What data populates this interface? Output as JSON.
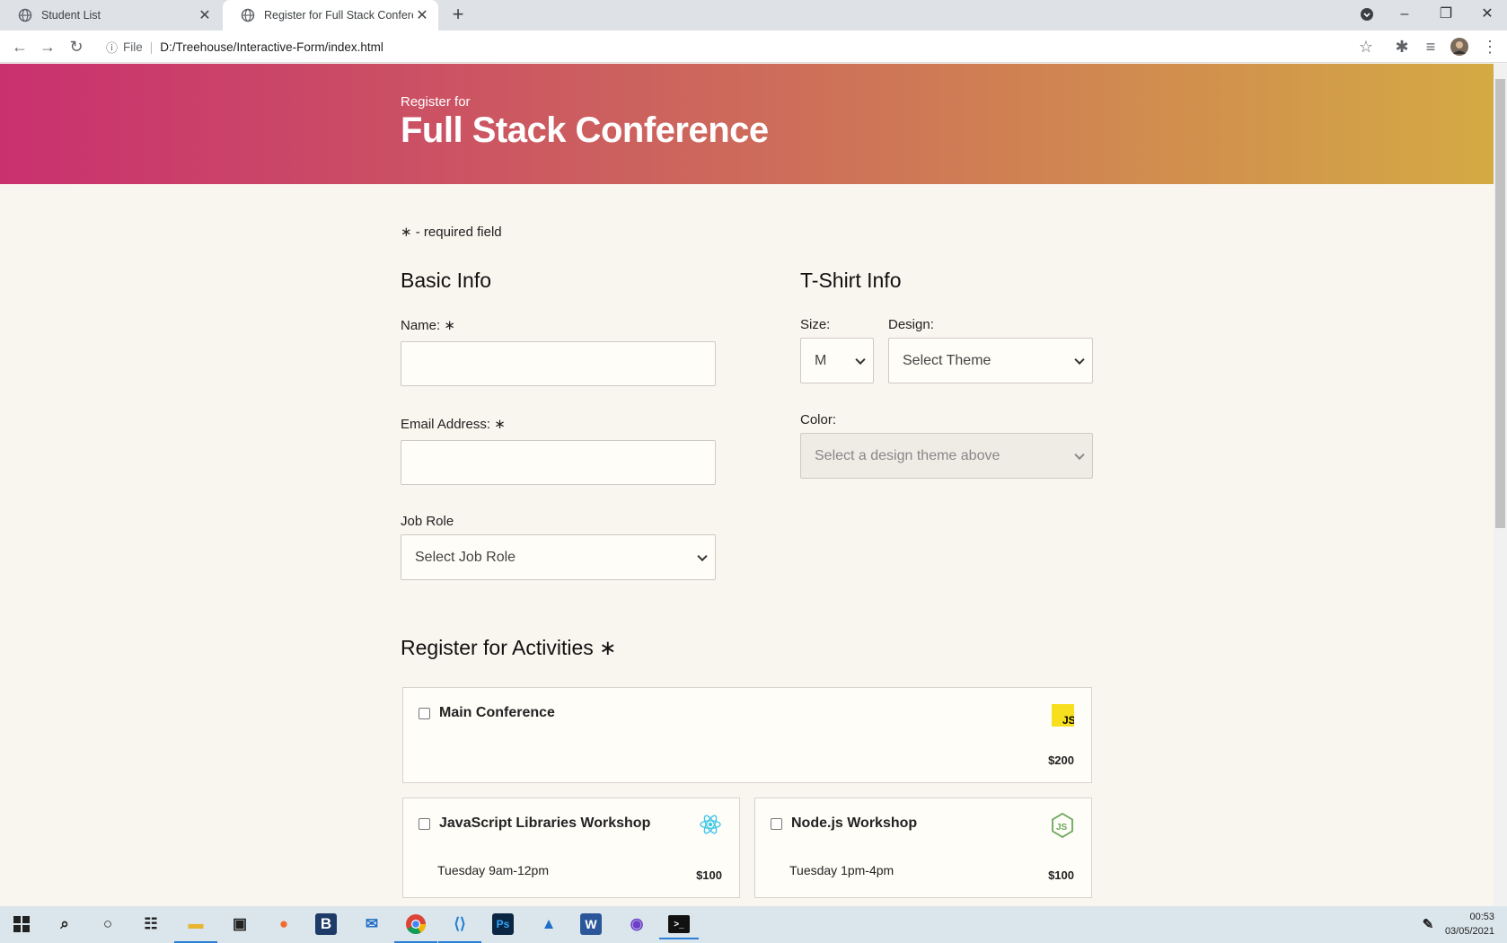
{
  "browser": {
    "tabs": [
      {
        "title": "Student List"
      },
      {
        "title": "Register for Full Stack Conference"
      }
    ],
    "address_prefix": "File",
    "url": "D:/Treehouse/Interactive-Form/index.html"
  },
  "header": {
    "subtitle": "Register for",
    "title": "Full Stack Conference"
  },
  "form": {
    "required_note": "- required field",
    "basic_info": {
      "heading": "Basic Info",
      "name_label": "Name:",
      "email_label": "Email Address:",
      "job_role_label": "Job Role",
      "job_role_value": "Select Job Role"
    },
    "tshirt": {
      "heading": "T-Shirt Info",
      "size_label": "Size:",
      "size_value": "M",
      "design_label": "Design:",
      "design_value": "Select Theme",
      "color_label": "Color:",
      "color_value": "Select a design theme above"
    },
    "activities": {
      "heading": "Register for Activities",
      "items": [
        {
          "name": "Main Conference",
          "when": "",
          "cost": "$200",
          "icon": "js-icon"
        },
        {
          "name": "JavaScript Libraries Workshop",
          "when": "Tuesday 9am-12pm",
          "cost": "$100",
          "icon": "react-icon"
        },
        {
          "name": "Node.js Workshop",
          "when": "Tuesday 1pm-4pm",
          "cost": "$100",
          "icon": "nodejs-icon"
        }
      ]
    }
  },
  "taskbar": {
    "time": "00:53",
    "date": "03/05/2021",
    "apps": [
      "start",
      "search",
      "cortana",
      "task-view",
      "file-explorer",
      "store",
      "firefox",
      "bitwarden",
      "mail",
      "chrome",
      "vscode",
      "photoshop",
      "photos",
      "word",
      "github-desktop",
      "terminal"
    ]
  },
  "colors": {
    "hero_start": "#c9306f",
    "hero_end": "#d4aa44",
    "page_bg": "#f9f5ef"
  }
}
